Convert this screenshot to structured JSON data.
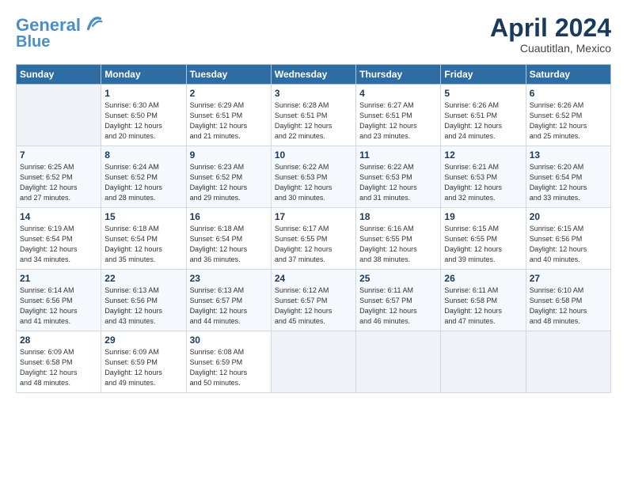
{
  "logo": {
    "line1": "General",
    "line2": "Blue"
  },
  "header": {
    "month": "April 2024",
    "location": "Cuautitlan, Mexico"
  },
  "weekdays": [
    "Sunday",
    "Monday",
    "Tuesday",
    "Wednesday",
    "Thursday",
    "Friday",
    "Saturday"
  ],
  "weeks": [
    [
      {
        "day": "",
        "info": ""
      },
      {
        "day": "1",
        "info": "Sunrise: 6:30 AM\nSunset: 6:50 PM\nDaylight: 12 hours\nand 20 minutes."
      },
      {
        "day": "2",
        "info": "Sunrise: 6:29 AM\nSunset: 6:51 PM\nDaylight: 12 hours\nand 21 minutes."
      },
      {
        "day": "3",
        "info": "Sunrise: 6:28 AM\nSunset: 6:51 PM\nDaylight: 12 hours\nand 22 minutes."
      },
      {
        "day": "4",
        "info": "Sunrise: 6:27 AM\nSunset: 6:51 PM\nDaylight: 12 hours\nand 23 minutes."
      },
      {
        "day": "5",
        "info": "Sunrise: 6:26 AM\nSunset: 6:51 PM\nDaylight: 12 hours\nand 24 minutes."
      },
      {
        "day": "6",
        "info": "Sunrise: 6:26 AM\nSunset: 6:52 PM\nDaylight: 12 hours\nand 25 minutes."
      }
    ],
    [
      {
        "day": "7",
        "info": "Sunrise: 6:25 AM\nSunset: 6:52 PM\nDaylight: 12 hours\nand 27 minutes."
      },
      {
        "day": "8",
        "info": "Sunrise: 6:24 AM\nSunset: 6:52 PM\nDaylight: 12 hours\nand 28 minutes."
      },
      {
        "day": "9",
        "info": "Sunrise: 6:23 AM\nSunset: 6:52 PM\nDaylight: 12 hours\nand 29 minutes."
      },
      {
        "day": "10",
        "info": "Sunrise: 6:22 AM\nSunset: 6:53 PM\nDaylight: 12 hours\nand 30 minutes."
      },
      {
        "day": "11",
        "info": "Sunrise: 6:22 AM\nSunset: 6:53 PM\nDaylight: 12 hours\nand 31 minutes."
      },
      {
        "day": "12",
        "info": "Sunrise: 6:21 AM\nSunset: 6:53 PM\nDaylight: 12 hours\nand 32 minutes."
      },
      {
        "day": "13",
        "info": "Sunrise: 6:20 AM\nSunset: 6:54 PM\nDaylight: 12 hours\nand 33 minutes."
      }
    ],
    [
      {
        "day": "14",
        "info": "Sunrise: 6:19 AM\nSunset: 6:54 PM\nDaylight: 12 hours\nand 34 minutes."
      },
      {
        "day": "15",
        "info": "Sunrise: 6:18 AM\nSunset: 6:54 PM\nDaylight: 12 hours\nand 35 minutes."
      },
      {
        "day": "16",
        "info": "Sunrise: 6:18 AM\nSunset: 6:54 PM\nDaylight: 12 hours\nand 36 minutes."
      },
      {
        "day": "17",
        "info": "Sunrise: 6:17 AM\nSunset: 6:55 PM\nDaylight: 12 hours\nand 37 minutes."
      },
      {
        "day": "18",
        "info": "Sunrise: 6:16 AM\nSunset: 6:55 PM\nDaylight: 12 hours\nand 38 minutes."
      },
      {
        "day": "19",
        "info": "Sunrise: 6:15 AM\nSunset: 6:55 PM\nDaylight: 12 hours\nand 39 minutes."
      },
      {
        "day": "20",
        "info": "Sunrise: 6:15 AM\nSunset: 6:56 PM\nDaylight: 12 hours\nand 40 minutes."
      }
    ],
    [
      {
        "day": "21",
        "info": "Sunrise: 6:14 AM\nSunset: 6:56 PM\nDaylight: 12 hours\nand 41 minutes."
      },
      {
        "day": "22",
        "info": "Sunrise: 6:13 AM\nSunset: 6:56 PM\nDaylight: 12 hours\nand 43 minutes."
      },
      {
        "day": "23",
        "info": "Sunrise: 6:13 AM\nSunset: 6:57 PM\nDaylight: 12 hours\nand 44 minutes."
      },
      {
        "day": "24",
        "info": "Sunrise: 6:12 AM\nSunset: 6:57 PM\nDaylight: 12 hours\nand 45 minutes."
      },
      {
        "day": "25",
        "info": "Sunrise: 6:11 AM\nSunset: 6:57 PM\nDaylight: 12 hours\nand 46 minutes."
      },
      {
        "day": "26",
        "info": "Sunrise: 6:11 AM\nSunset: 6:58 PM\nDaylight: 12 hours\nand 47 minutes."
      },
      {
        "day": "27",
        "info": "Sunrise: 6:10 AM\nSunset: 6:58 PM\nDaylight: 12 hours\nand 48 minutes."
      }
    ],
    [
      {
        "day": "28",
        "info": "Sunrise: 6:09 AM\nSunset: 6:58 PM\nDaylight: 12 hours\nand 48 minutes."
      },
      {
        "day": "29",
        "info": "Sunrise: 6:09 AM\nSunset: 6:59 PM\nDaylight: 12 hours\nand 49 minutes."
      },
      {
        "day": "30",
        "info": "Sunrise: 6:08 AM\nSunset: 6:59 PM\nDaylight: 12 hours\nand 50 minutes."
      },
      {
        "day": "",
        "info": ""
      },
      {
        "day": "",
        "info": ""
      },
      {
        "day": "",
        "info": ""
      },
      {
        "day": "",
        "info": ""
      }
    ]
  ]
}
